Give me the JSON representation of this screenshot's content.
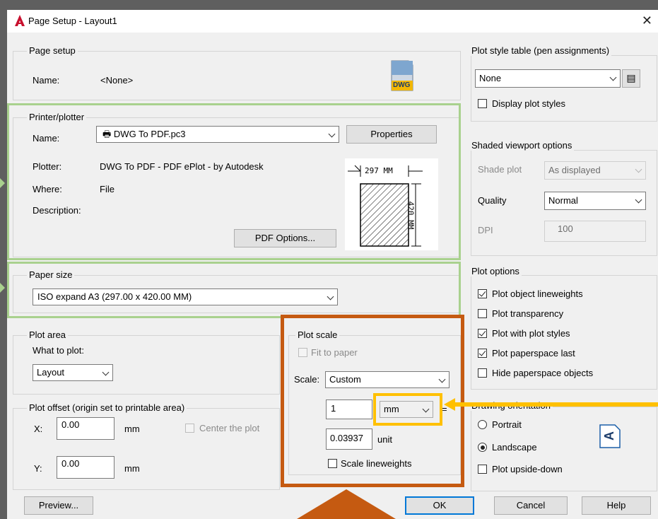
{
  "window": {
    "title": "Page Setup - Layout1"
  },
  "page_setup": {
    "legend": "Page setup",
    "name_label": "Name:",
    "name_value": "<None>",
    "icon_text": "DWG"
  },
  "printer": {
    "legend": "Printer/plotter",
    "name_label": "Name:",
    "name_value": "DWG To PDF.pc3",
    "properties_button": "Properties",
    "plotter_label": "Plotter:",
    "plotter_value": "DWG To PDF - PDF ePlot - by Autodesk",
    "where_label": "Where:",
    "where_value": "File",
    "description_label": "Description:",
    "pdf_options_button": "PDF Options...",
    "preview_width_text": "297 MM",
    "preview_height_text": "420 MM"
  },
  "paper_size": {
    "legend": "Paper size",
    "value": "ISO expand A3 (297.00 x 420.00 MM)"
  },
  "plot_area": {
    "legend": "Plot area",
    "what_label": "What to plot:",
    "what_value": "Layout"
  },
  "plot_offset": {
    "legend": "Plot offset (origin set to printable area)",
    "x_label": "X:",
    "x_value": "0.00",
    "x_unit": "mm",
    "y_label": "Y:",
    "y_value": "0.00",
    "y_unit": "mm",
    "center_label": "Center the plot"
  },
  "plot_scale": {
    "legend": "Plot scale",
    "fit_label": "Fit to paper",
    "scale_label": "Scale:",
    "scale_value": "Custom",
    "value1": "1",
    "unit1": "mm",
    "equals": "=",
    "value2": "0.03937",
    "unit2": "unit",
    "lineweights_label": "Scale lineweights"
  },
  "plot_style": {
    "legend": "Plot style table (pen assignments)",
    "value": "None",
    "display_label": "Display plot styles"
  },
  "shaded": {
    "legend": "Shaded viewport options",
    "shade_label": "Shade plot",
    "shade_value": "As displayed",
    "quality_label": "Quality",
    "quality_value": "Normal",
    "dpi_label": "DPI",
    "dpi_value": "100"
  },
  "plot_options": {
    "legend": "Plot options",
    "items": [
      {
        "label": "Plot object lineweights",
        "checked": true
      },
      {
        "label": "Plot transparency",
        "checked": false
      },
      {
        "label": "Plot with plot styles",
        "checked": true
      },
      {
        "label": "Plot paperspace last",
        "checked": true
      },
      {
        "label": "Hide paperspace objects",
        "checked": false
      }
    ]
  },
  "orientation": {
    "legend": "Drawing orientation",
    "portrait": "Portrait",
    "landscape": "Landscape",
    "upside_down": "Plot upside-down",
    "icon_letter": "A"
  },
  "buttons": {
    "preview": "Preview...",
    "ok": "OK",
    "cancel": "Cancel",
    "help": "Help"
  },
  "colors": {
    "highlight_green": "#a9d18e",
    "highlight_brown": "#c55a11",
    "highlight_yellow": "#ffc000",
    "accent_blue": "#0078d7",
    "autocad_red": "#c8102e"
  }
}
